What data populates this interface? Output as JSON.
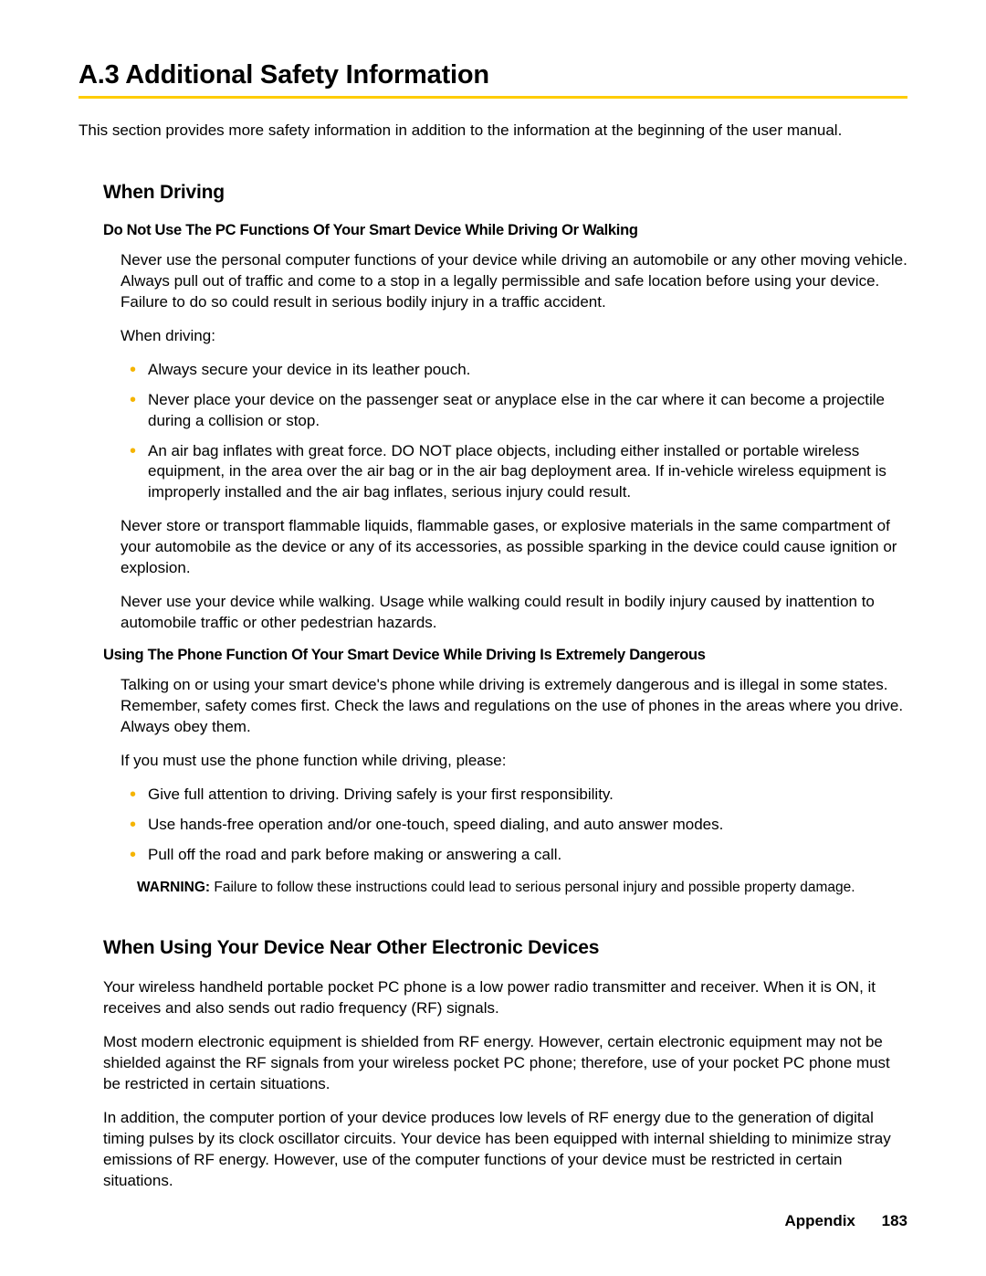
{
  "title": "A.3  Additional Safety Information",
  "intro": "This section provides more safety information in addition to the information at the beginning of the user manual.",
  "sec1": {
    "heading": "When Driving",
    "sub1": {
      "heading": "Do Not Use The PC Functions Of Your Smart Device While Driving Or Walking",
      "p1": "Never use the personal computer functions of your device while driving an automobile or any other moving vehicle. Always pull out of traffic and come to a stop in a legally permissible and safe location before using your device. Failure to do so could result in serious bodily injury in a traffic accident.",
      "p2": "When driving:",
      "bullets": [
        "Always secure your device in its leather pouch.",
        "Never place your device on the passenger seat or anyplace else in the car where it can become a projectile during a collision or stop.",
        "An air bag inflates with great force. DO NOT place objects, including either installed or portable wireless equipment, in the area over the air bag or in the air bag deployment area. If in-vehicle wireless equipment is improperly installed and the air bag inflates, serious injury could result."
      ],
      "p3": "Never store or transport flammable liquids, flammable gases, or explosive materials in the same compartment of your automobile as the device or any of its accessories, as possible sparking in the device could cause ignition or explosion.",
      "p4": "Never use your device while walking. Usage while walking could result in bodily injury caused by inattention to automobile traffic or other pedestrian hazards."
    },
    "sub2": {
      "heading": "Using The Phone Function Of Your Smart Device While Driving Is Extremely Dangerous",
      "p1": "Talking on or using your smart device's phone while driving is extremely dangerous and is illegal in some states. Remember, safety comes first. Check the laws and regulations on the use of phones in the areas where you drive. Always obey them.",
      "p2": "If you must use the phone function while driving, please:",
      "bullets": [
        "Give full attention to driving. Driving safely is your first responsibility.",
        "Use hands-free operation and/or one-touch, speed dialing, and auto answer modes.",
        "Pull off the road and park before making or answering a call."
      ],
      "warning_label": "WARNING:",
      "warning_text": "  Failure to follow these instructions could lead to serious personal injury and possible property damage."
    }
  },
  "sec2": {
    "heading": "When Using Your Device Near Other Electronic Devices",
    "p1": "Your wireless handheld portable pocket PC phone is a low power radio transmitter and receiver. When it is ON, it receives and also sends out radio frequency (RF) signals.",
    "p2": "Most modern electronic equipment is shielded from RF energy. However, certain electronic equipment may not be shielded against the RF signals from your wireless pocket PC phone; therefore, use of your pocket PC phone must be restricted in certain situations.",
    "p3": "In addition, the computer portion of your device produces low levels of RF energy due to the generation of digital timing pulses by its clock oscillator circuits. Your device has been equipped with internal shielding to minimize stray emissions of RF energy. However, use of the computer functions of your device must be restricted in certain situations."
  },
  "footer": {
    "section": "Appendix",
    "page": "183"
  }
}
